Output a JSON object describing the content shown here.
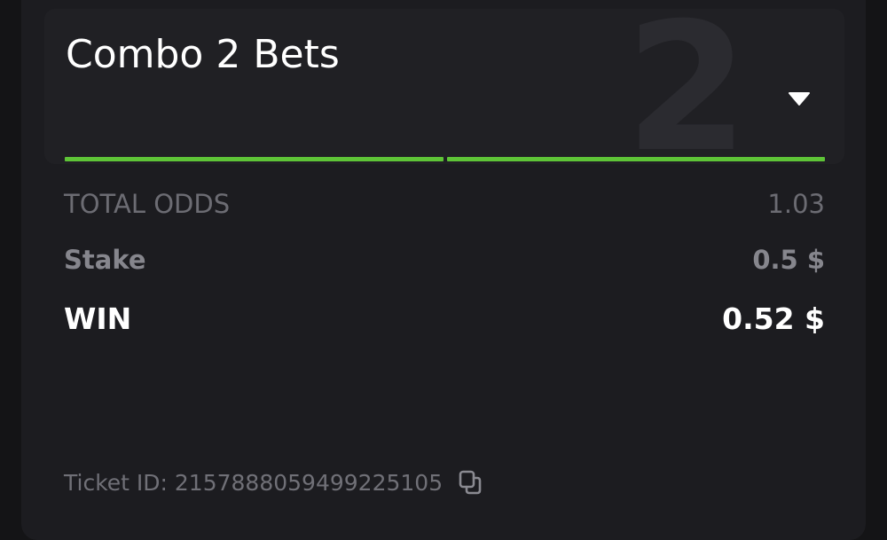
{
  "bet": {
    "title": "Combo 2 Bets",
    "bet_count_watermark": "2",
    "legs_progress": [
      1,
      1
    ]
  },
  "summary": {
    "total_odds_label": "TOTAL ODDS",
    "total_odds_value": "1.03",
    "stake_label": "Stake",
    "stake_value": "0.5 $",
    "win_label": "WIN",
    "win_value": "0.52 $"
  },
  "ticket": {
    "text": "Ticket ID: 2157888059499225105"
  },
  "icons": {
    "dropdown": "chevron-down-icon",
    "copy": "copy-icon"
  },
  "colors": {
    "accent_green": "#5ec437",
    "background": "#141416",
    "card": "#1c1c20"
  }
}
